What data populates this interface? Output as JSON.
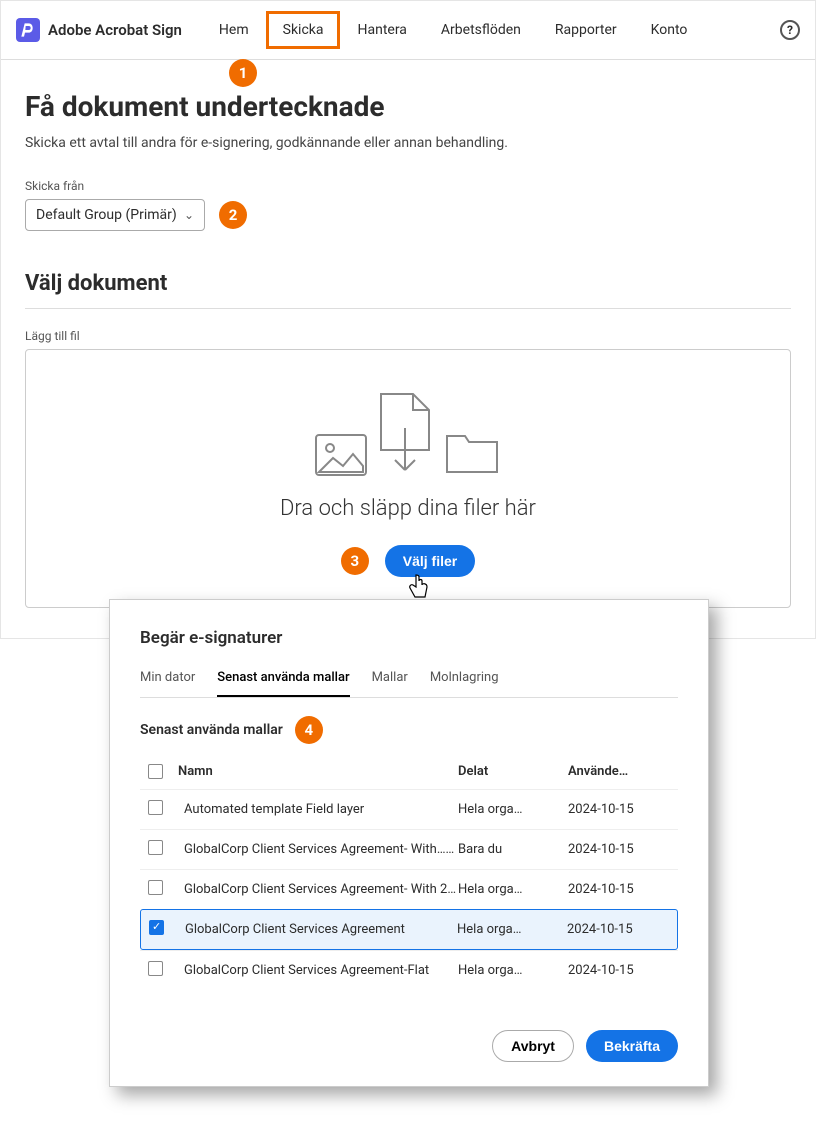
{
  "brand": "Adobe Acrobat Sign",
  "nav": {
    "items": [
      "Hem",
      "Skicka",
      "Hantera",
      "Arbetsflöden",
      "Rapporter",
      "Konto"
    ],
    "highlighted_index": 1
  },
  "page": {
    "title": "Få dokument undertecknade",
    "subtitle": "Skicka ett avtal till andra för e-signering, godkännande eller annan behandling."
  },
  "send_from": {
    "label": "Skicka från",
    "value": "Default Group (Primär)"
  },
  "select_docs": {
    "heading": "Välj dokument",
    "add_file_label": "Lägg till fil",
    "dropzone_text": "Dra och släpp dina filer här",
    "choose_files_btn": "Välj filer"
  },
  "modal": {
    "title": "Begär e-signaturer",
    "tabs": [
      "Min dator",
      "Senast använda mallar",
      "Mallar",
      "Molnlagring"
    ],
    "active_tab_index": 1,
    "section_title": "Senast använda mallar",
    "columns": {
      "name": "Namn",
      "shared": "Delat",
      "used": "Använde…"
    },
    "rows": [
      {
        "checked": false,
        "name": "Automated template Field layer",
        "shared": "Hela orga…",
        "date": "2024-10-15"
      },
      {
        "checked": false,
        "name": "GlobalCorp Client Services Agreement- With……",
        "shared": "Bara du",
        "date": "2024-10-15"
      },
      {
        "checked": false,
        "name": "GlobalCorp Client Services Agreement- With 2……",
        "shared": "Hela orga…",
        "date": "2024-10-15"
      },
      {
        "checked": true,
        "name": "GlobalCorp Client Services Agreement",
        "shared": "Hela orga…",
        "date": "2024-10-15"
      },
      {
        "checked": false,
        "name": "GlobalCorp Client Services Agreement-Flat",
        "shared": "Hela orga…",
        "date": "2024-10-15"
      }
    ],
    "cancel": "Avbryt",
    "confirm": "Bekräfta"
  },
  "badges": {
    "b1": "1",
    "b2": "2",
    "b3": "3",
    "b4": "4"
  }
}
